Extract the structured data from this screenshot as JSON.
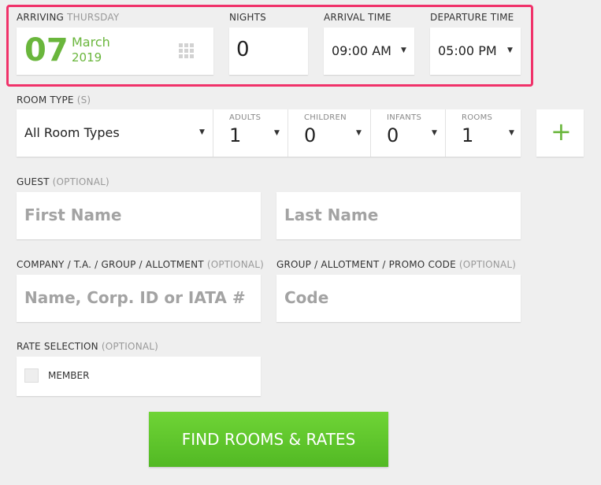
{
  "arrival": {
    "label": "ARRIVING",
    "day_name": "THURSDAY",
    "day": "07",
    "month": "March",
    "year": "2019"
  },
  "nights": {
    "label": "NIGHTS",
    "value": "0"
  },
  "arrival_time": {
    "label": "ARRIVAL TIME",
    "value": "09:00 AM"
  },
  "departure_time": {
    "label": "DEPARTURE TIME",
    "value": "05:00 PM"
  },
  "room_type": {
    "label": "ROOM TYPE",
    "suffix": "(S)",
    "value": "All Room Types"
  },
  "occupancy": {
    "adults": {
      "label": "ADULTS",
      "value": "1"
    },
    "children": {
      "label": "CHILDREN",
      "value": "0"
    },
    "infants": {
      "label": "INFANTS",
      "value": "0"
    },
    "rooms": {
      "label": "ROOMS",
      "value": "1"
    }
  },
  "add_room": {
    "symbol": "+"
  },
  "guest": {
    "label": "GUEST",
    "optional": "(OPTIONAL)",
    "first_placeholder": "First Name",
    "last_placeholder": "Last Name"
  },
  "company": {
    "label": "COMPANY / T.A. / GROUP / ALLOTMENT",
    "optional": "(OPTIONAL)",
    "placeholder": "Name, Corp. ID or IATA #"
  },
  "promo": {
    "label": "GROUP / ALLOTMENT / PROMO CODE",
    "optional": "(OPTIONAL)",
    "placeholder": "Code"
  },
  "rate": {
    "label": "RATE SELECTION",
    "optional": "(OPTIONAL)",
    "option": "MEMBER"
  },
  "submit": {
    "label": "FIND ROOMS & RATES"
  },
  "colors": {
    "accent_green": "#6ab63c",
    "highlight": "#f0326a",
    "button_green": "#5cc52b"
  }
}
